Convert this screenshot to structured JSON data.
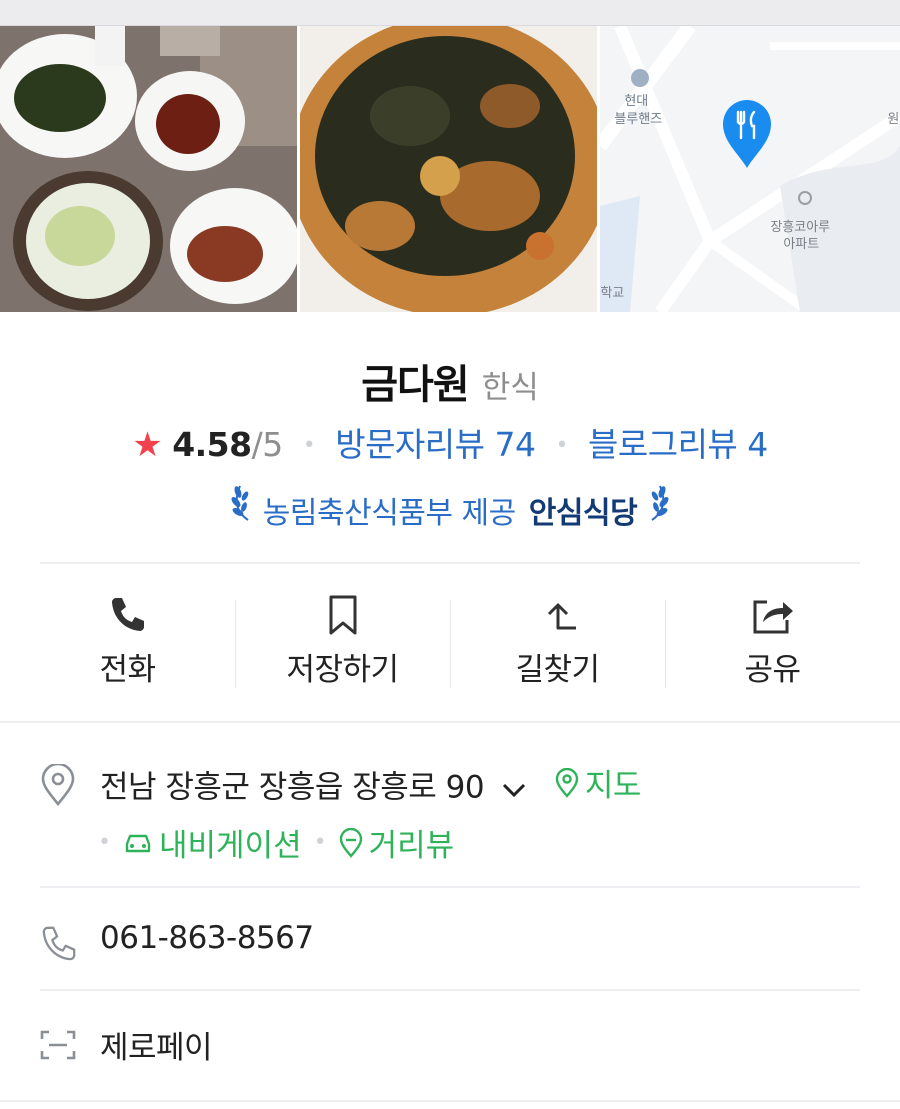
{
  "restaurant": {
    "name": "금다원",
    "category": "한식",
    "rating": "4.58",
    "rating_max": "/5",
    "visitor_reviews": "방문자리뷰 74",
    "blog_reviews": "블로그리뷰 4",
    "certification_provider": "농림축산식품부 제공",
    "certification_badge": "안심식당"
  },
  "map": {
    "labels": [
      "현대",
      "블루핸즈",
      "장흥코아루",
      "아파트",
      "학교",
      "원"
    ]
  },
  "actions": [
    {
      "label": "전화",
      "icon": "phone-icon"
    },
    {
      "label": "저장하기",
      "icon": "bookmark-icon"
    },
    {
      "label": "길찾기",
      "icon": "directions-icon"
    },
    {
      "label": "공유",
      "icon": "share-icon"
    }
  ],
  "address": {
    "text": "전남 장흥군 장흥읍 장흥로 90",
    "map_link": "지도",
    "navigation_link": "내비게이션",
    "streetview_link": "거리뷰"
  },
  "phone": "061-863-8567",
  "payment": "제로페이",
  "colors": {
    "accent_blue": "#2a6dc7",
    "star_red": "#f0424d",
    "link_green": "#2fb35a",
    "map_pin": "#1a8cf0"
  }
}
